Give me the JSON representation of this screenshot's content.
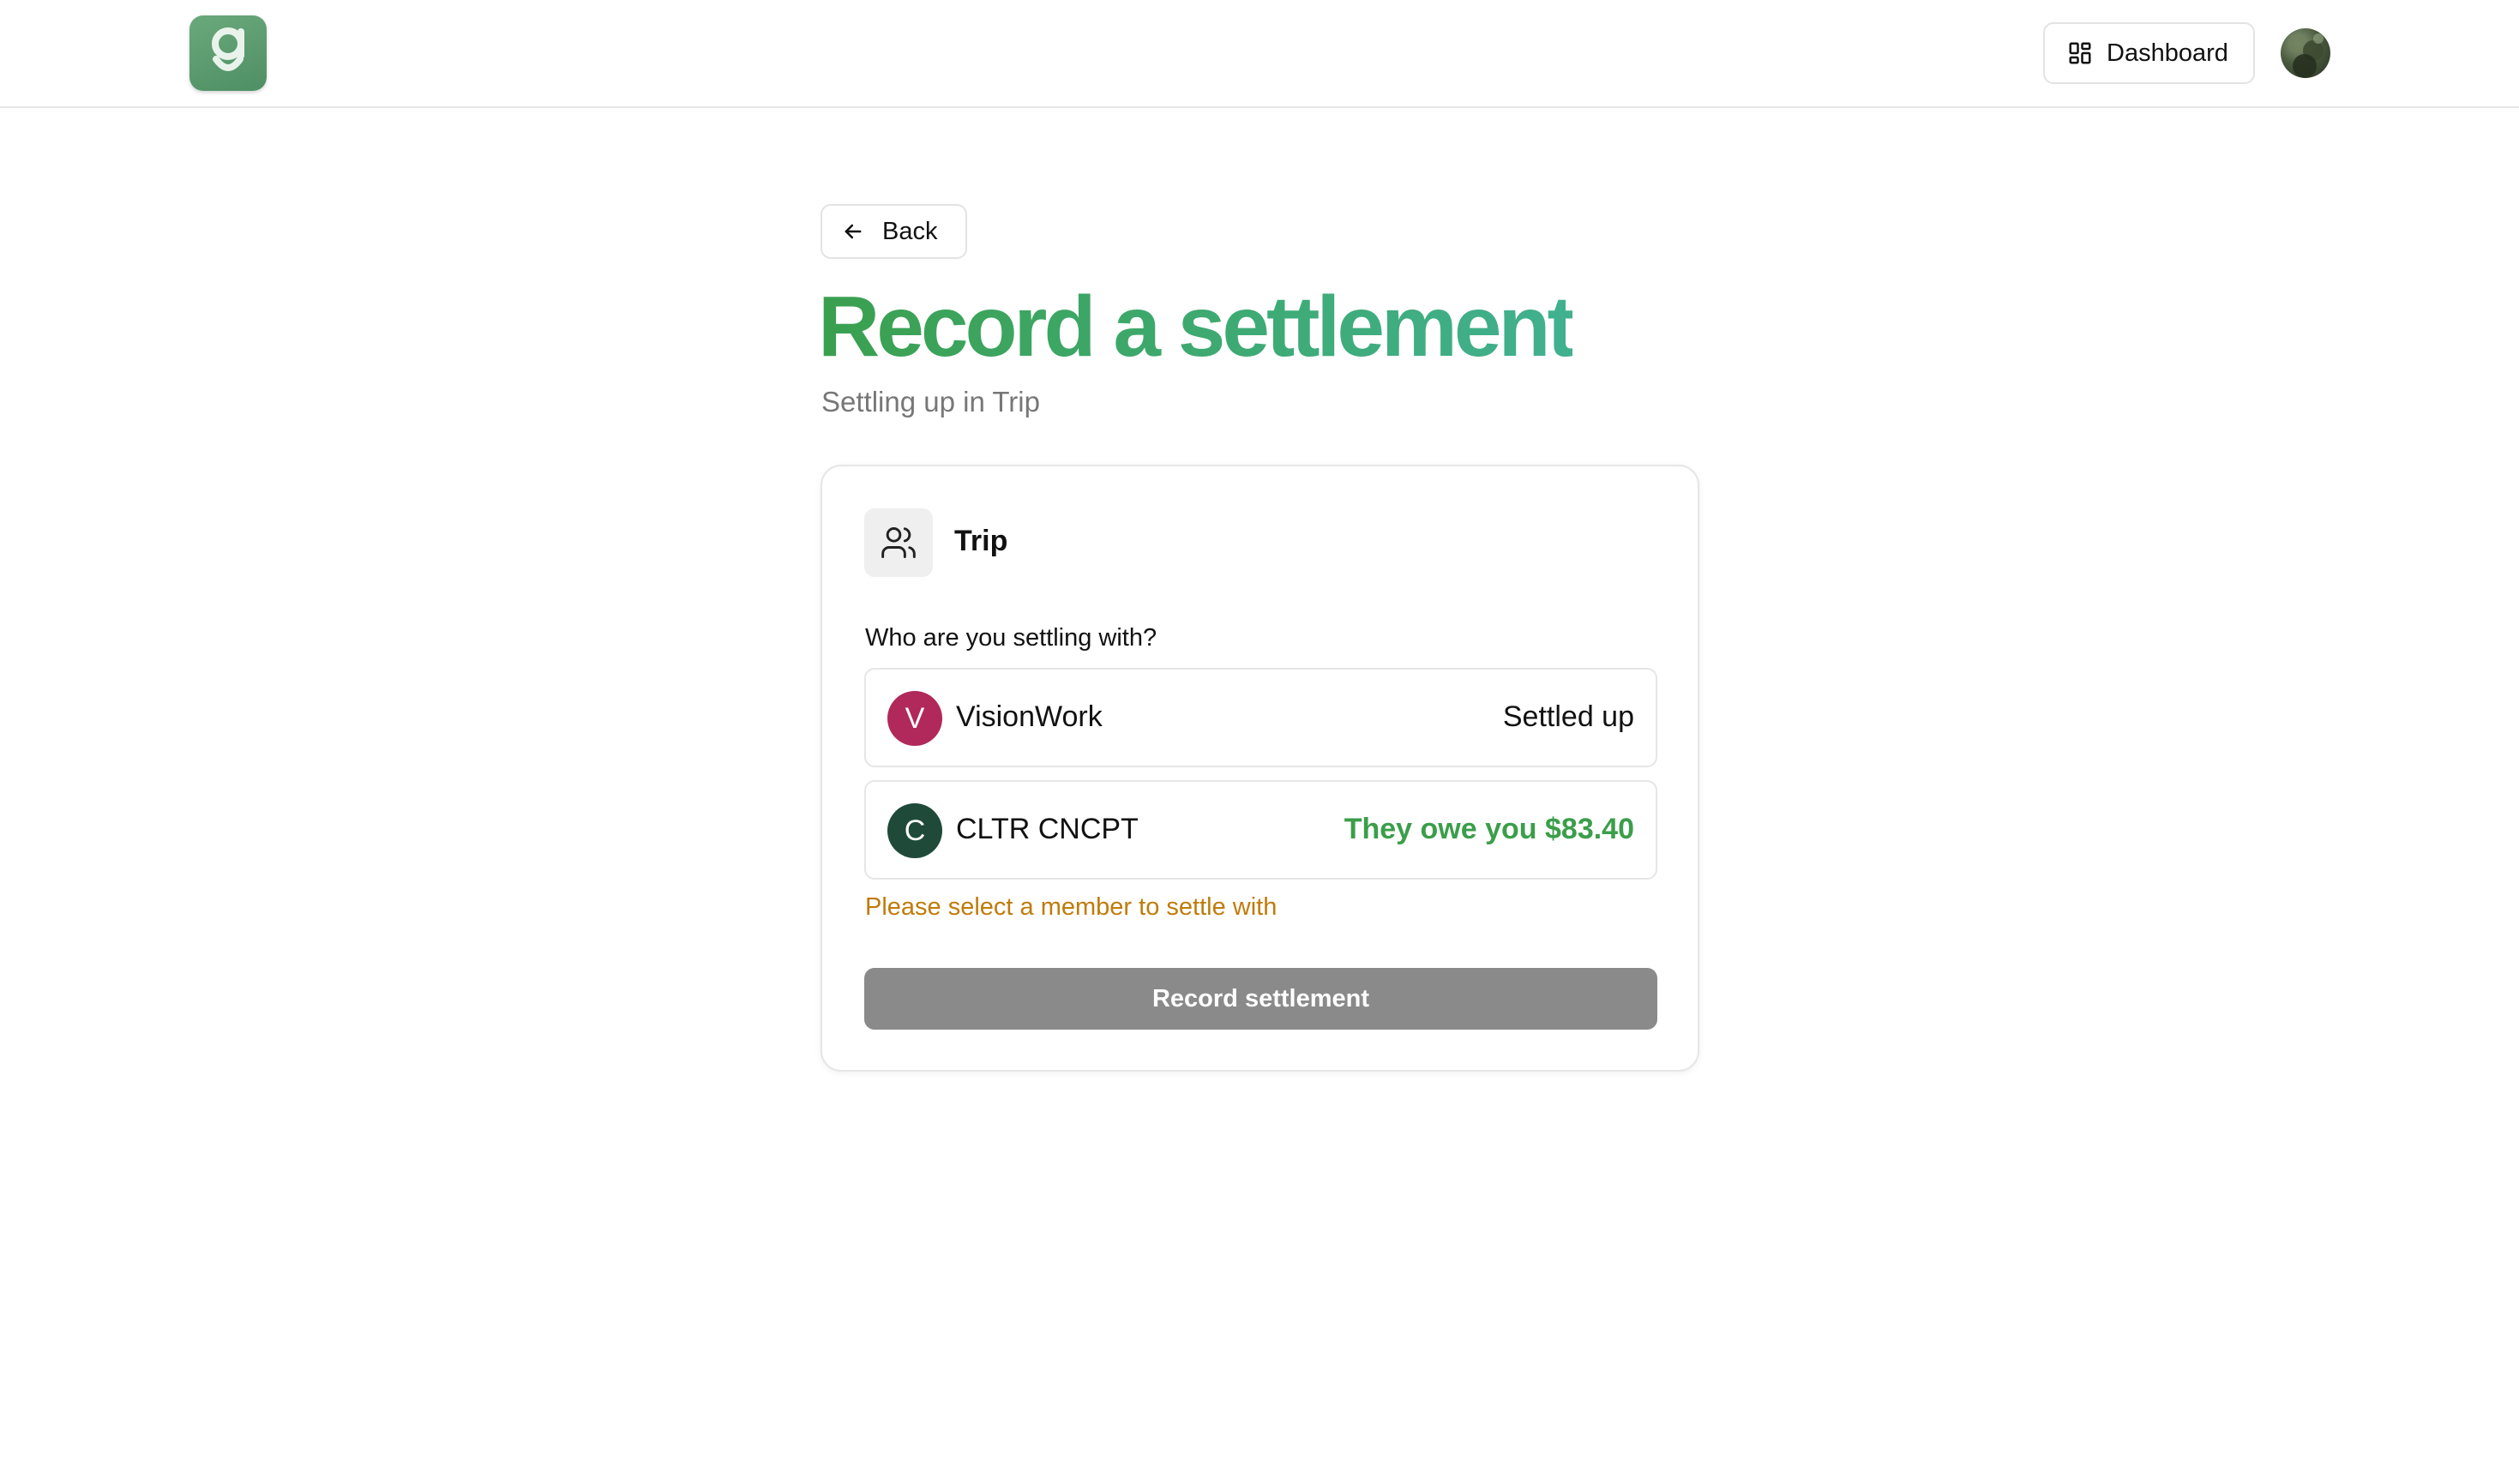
{
  "header": {
    "logo_letter": "g",
    "dashboard_label": "Dashboard",
    "dashboard_icon": "dashboard-grid-icon",
    "avatar_icon": "user-avatar"
  },
  "back": {
    "label": "Back",
    "icon": "arrow-left-icon"
  },
  "page": {
    "title": "Record a settlement",
    "subtitle": "Settling up in Trip"
  },
  "card": {
    "group_icon": "users-icon",
    "group_name": "Trip",
    "question": "Who are you settling with?",
    "members": [
      {
        "initial": "V",
        "name": "VisionWork",
        "status": "Settled up",
        "avatar_color": "#b0295a"
      },
      {
        "initial": "C",
        "name": "CLTR CNCPT",
        "status": "They owe you $83.40",
        "avatar_color": "#1f4a3a"
      }
    ],
    "warning": "Please select a member to settle with",
    "submit_label": "Record settlement"
  },
  "colors": {
    "brand_green": "#3aa04f",
    "owed_green": "#3b9e4a",
    "warning_amber": "#c07b0a",
    "disabled_button": "#8a8a8a"
  }
}
